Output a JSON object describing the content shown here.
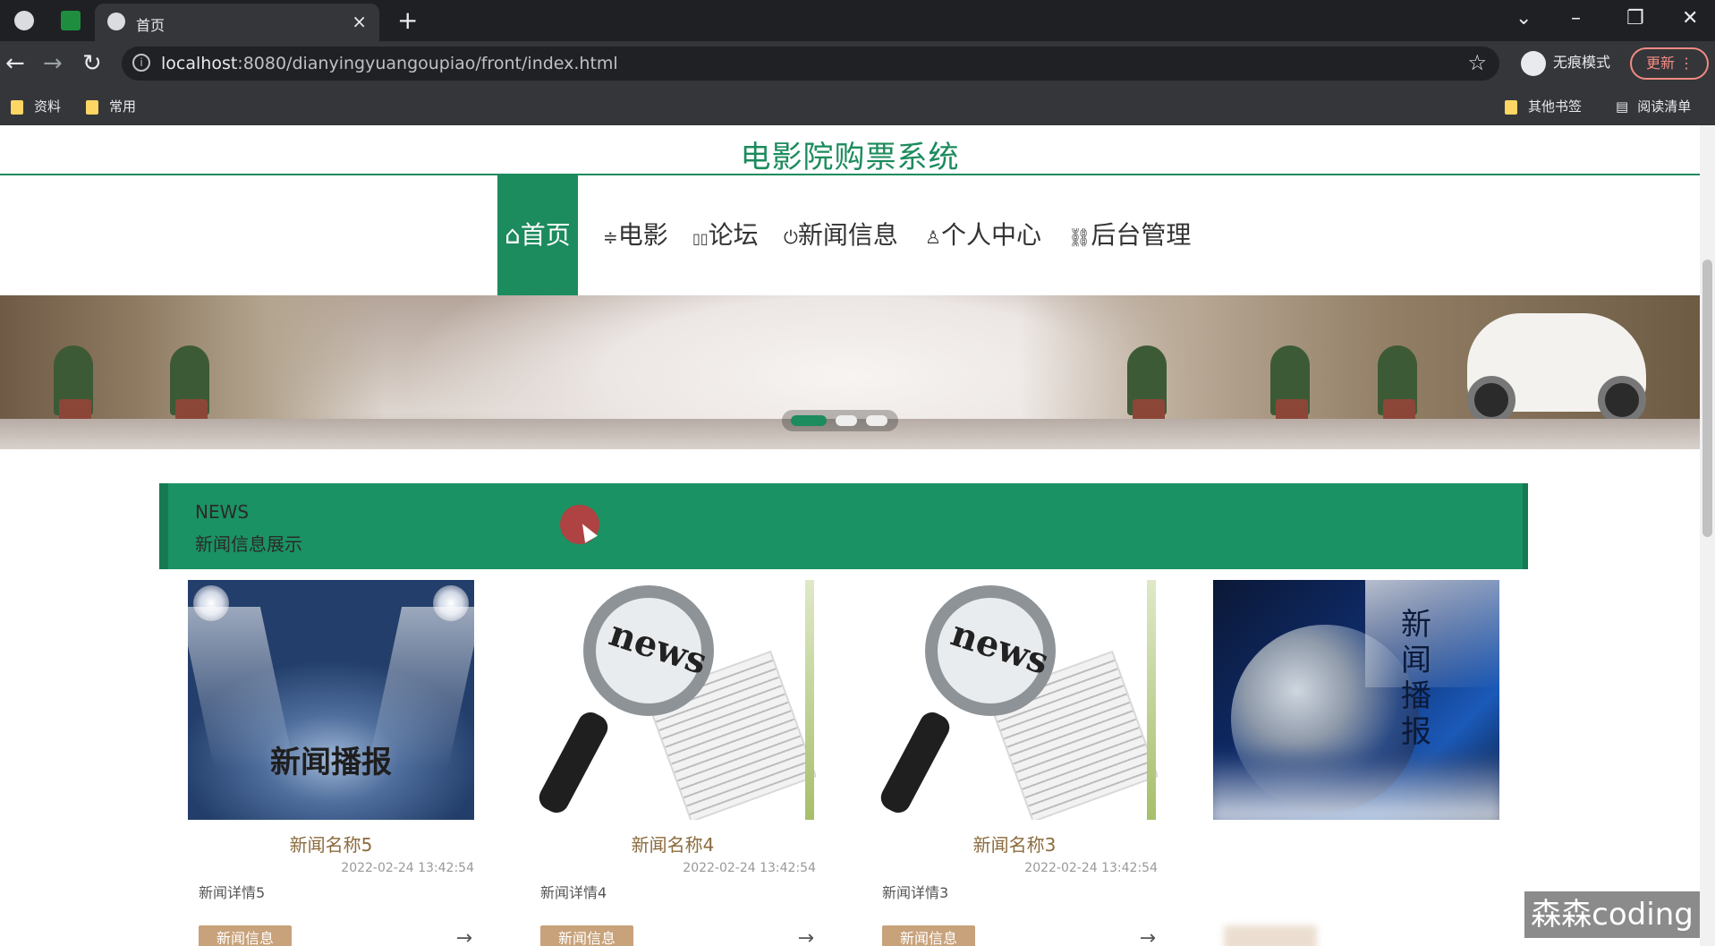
{
  "browser": {
    "tab_title": "首页",
    "url_host": "localhost",
    "url_rest": ":8080/dianyingyuangoupiao/front/index.html",
    "incognito_label": "无痕模式",
    "update_label": "更新",
    "bookmarks": [
      "资料",
      "常用"
    ],
    "other_bookmarks": "其他书签",
    "reading_list": "阅读清单"
  },
  "site": {
    "title": "电影院购票系统",
    "nav": [
      {
        "icon": "⌂",
        "label": "首页",
        "active": true
      },
      {
        "icon": "≑",
        "label": "电影",
        "active": false
      },
      {
        "icon": "▯▯",
        "label": "论坛",
        "active": false
      },
      {
        "icon": "⏻",
        "label": "新闻信息",
        "active": false
      },
      {
        "icon": "♙",
        "label": "个人中心",
        "active": false
      },
      {
        "icon": "⛓",
        "label": "后台管理",
        "active": false
      }
    ],
    "carousel": {
      "slides": 3,
      "active_index": 0
    }
  },
  "news_section": {
    "title_en": "NEWS",
    "title_cn": "新闻信息展示",
    "items": [
      {
        "name": "新闻名称5",
        "time": "2022-02-24 13:42:54",
        "detail": "新闻详情5",
        "tag": "新闻信息",
        "image_text": "新闻播报"
      },
      {
        "name": "新闻名称4",
        "time": "2022-02-24 13:42:54",
        "detail": "新闻详情4",
        "tag": "新闻信息",
        "image_text": "news"
      },
      {
        "name": "新闻名称3",
        "time": "2022-02-24 13:42:54",
        "detail": "新闻详情3",
        "tag": "新闻信息",
        "image_text": "news"
      },
      {
        "name": "",
        "time": "",
        "detail": "",
        "tag": "",
        "image_text": "新闻播报"
      }
    ],
    "arrow": "→"
  },
  "watermark": "森森coding",
  "colors": {
    "brand": "#1c8b5d",
    "tag": "#c8a27b",
    "name": "#8b6b3d"
  }
}
